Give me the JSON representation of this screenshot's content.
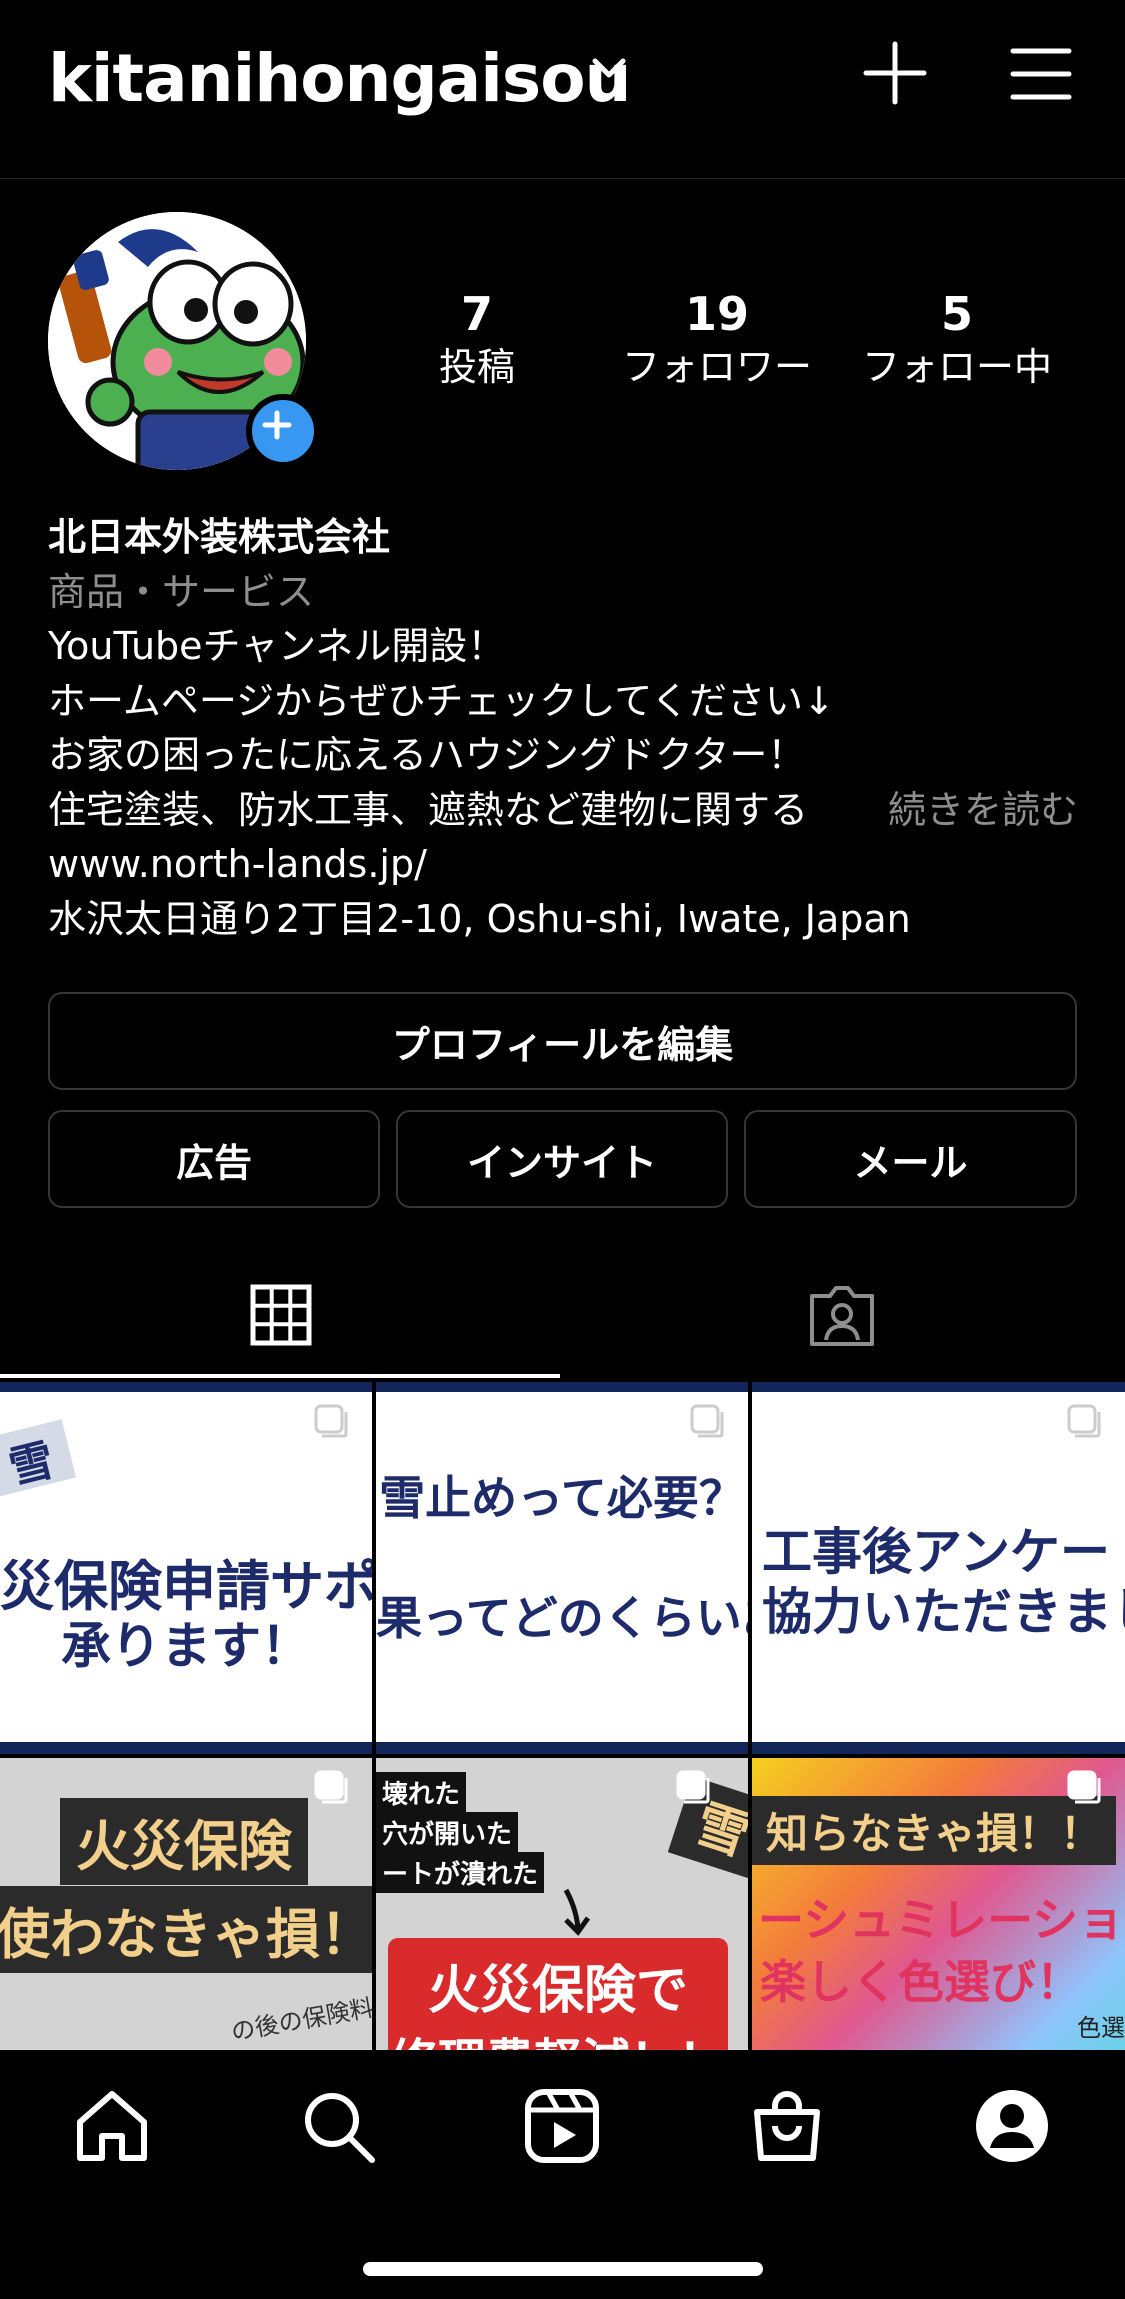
{
  "header": {
    "username": "kitanihongaisou"
  },
  "profile": {
    "stats": [
      {
        "value": "7",
        "label": "投稿"
      },
      {
        "value": "19",
        "label": "フォロワー"
      },
      {
        "value": "5",
        "label": "フォロー中"
      }
    ],
    "name": "北日本外装株式会社",
    "category": "商品・サービス",
    "bio_lines": [
      "YouTubeチャンネル開設！",
      "ホームページからぜひチェックしてください↓",
      "お家の困ったに応えるハウジングドクター！",
      "住宅塗装、防水工事、遮熱など建物に関する"
    ],
    "more_label": "続きを読む",
    "website": "www.north-lands.jp/",
    "address": "水沢太日通り2丁目2-10, Oshu-shi, Iwate, Japan"
  },
  "buttons": {
    "edit_profile": "プロフィールを編集",
    "ads": "広告",
    "insights": "インサイト",
    "email": "メール"
  },
  "posts": [
    {
      "line1": "災保険申請サポー",
      "line2": "承ります！",
      "corner": "雪"
    },
    {
      "line1": "雪止めって必要？",
      "line2": "果ってどのくらいある"
    },
    {
      "line1": "工事後アンケート",
      "line2": "協力いただきまし"
    },
    {
      "line1": "火災保険",
      "line2": "使わなきゃ損！",
      "small": "の後の保険料"
    },
    {
      "notes": [
        "壊れた",
        "穴が開いた",
        "ートが潰れた"
      ],
      "line1": "火災保険で",
      "line2": "修理費軽減！！",
      "corner": "雪"
    },
    {
      "line1": "知らなきゃ損！！",
      "line2": "ーシュミレーショ",
      "line3": "楽しく色選び！",
      "small": "色選"
    }
  ],
  "colors": {
    "accent_blue": "#3897f0",
    "post_navy": "#12265a",
    "post_red": "#d92b2b",
    "post_cream": "#f3cf8c"
  },
  "nav_icons": [
    "home-icon",
    "search-icon",
    "reels-icon",
    "shop-icon",
    "profile-icon"
  ]
}
